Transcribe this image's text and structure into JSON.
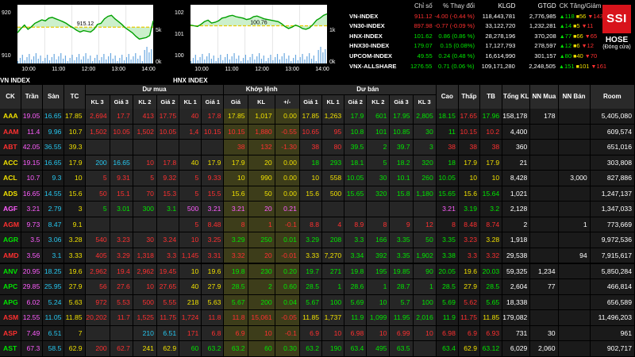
{
  "charts": [
    {
      "title": "VN INDEX",
      "ref_label": "915.12",
      "y_ticks": [
        "920",
        "910"
      ],
      "v_ticks": [
        "5k",
        "0k"
      ],
      "x_ticks": [
        "10:00",
        "11:00",
        "12:00",
        "13:00",
        "14:00"
      ]
    },
    {
      "title": "HNX INDEX",
      "ref_label": "100.76",
      "y_ticks": [
        "102",
        "101",
        "100"
      ],
      "v_ticks": [
        "1k",
        "0k"
      ],
      "x_ticks": [
        "10:00",
        "11:00",
        "12:00",
        "13:00",
        "14:00"
      ]
    }
  ],
  "index_table": {
    "headers": [
      "Chỉ số",
      "% Thay đổi",
      "KLGD",
      "GTGD",
      "CK Tăng/Giảm"
    ],
    "rows": [
      {
        "name": "VN-INDEX",
        "value": "911.12",
        "change": "-4.00 (-0.44 %)",
        "volume": "118,443,781",
        "value_traded": "2,776,985",
        "up": "118",
        "ref": "56",
        "down": "143",
        "dir": "dn"
      },
      {
        "name": "VN30-INDEX",
        "value": "897.98",
        "change": "-0.77 (-0.09 %)",
        "volume": "33,122,720",
        "value_traded": "1,232,281",
        "up": "14",
        "ref": "5",
        "down": "11",
        "dir": "dn"
      },
      {
        "name": "HNX-INDEX",
        "value": "101.62",
        "change": "0.86 (0.86 %)",
        "volume": "28,278,196",
        "value_traded": "370,208",
        "up": "77",
        "ref": "66",
        "down": "65",
        "dir": "up"
      },
      {
        "name": "HNX30-INDEX",
        "value": "179.07",
        "change": "0.15 (0.08%)",
        "volume": "17,127,793",
        "value_traded": "278,597",
        "up": "12",
        "ref": "6",
        "down": "12",
        "dir": "up"
      },
      {
        "name": "UPCOM-INDEX",
        "value": "49.55",
        "change": "0.24 (0.48 %)",
        "volume": "16,614,990",
        "value_traded": "301,157",
        "up": "80",
        "ref": "40",
        "down": "70",
        "dir": "up"
      },
      {
        "name": "VNX-ALLSHARE",
        "value": "1276.55",
        "change": "0.71 (0.06 %)",
        "volume": "109,171,280",
        "value_traded": "2,248,505",
        "up": "151",
        "ref": "101",
        "down": "161",
        "dir": "up"
      }
    ]
  },
  "brand": {
    "logo": "SSI",
    "exchange": "HOSE",
    "status": "(Đóng cửa)"
  },
  "board": {
    "groups": [
      "Dư mua",
      "Khớp lệnh",
      "Dư bán"
    ],
    "columns": [
      "CK",
      "Trần",
      "Sàn",
      "TC",
      "KL 3",
      "Giá 3",
      "KL 2",
      "Giá 2",
      "KL 1",
      "Giá 1",
      "Giá",
      "KL",
      "+/-",
      "Giá 1",
      "KL 1",
      "Giá 2",
      "KL 2",
      "Giá 3",
      "KL 3",
      "Cao",
      "Thấp",
      "TB",
      "Tổng KL",
      "NN Mua",
      "NN Bán",
      "Room"
    ],
    "rows": [
      [
        "AAA",
        "19.05",
        "16.65",
        "17.85",
        "2,694",
        "17.7",
        "413",
        "17.75",
        "40",
        "17.8",
        "17.85",
        "1,017",
        "0.00",
        "17.85",
        "1,263",
        "17.9",
        "601",
        "17.95",
        "2,805",
        "18.15",
        "17.65",
        "17.96",
        "158,178",
        "178",
        "",
        "5,405,080"
      ],
      [
        "AAM",
        "11.4",
        "9.96",
        "10.7",
        "1,502",
        "10.05",
        "1,502",
        "10.05",
        "1,4",
        "10.15",
        "10.15",
        "1,880",
        "-0.55",
        "10.65",
        "95",
        "10.8",
        "101",
        "10.85",
        "30",
        "11",
        "10.15",
        "10.2",
        "4,400",
        "",
        "",
        "609,574"
      ],
      [
        "ABT",
        "42.05",
        "36.55",
        "39.3",
        "",
        "",
        "",
        "",
        "",
        "",
        "38",
        "132",
        "-1.30",
        "38",
        "80",
        "39.5",
        "2",
        "39.7",
        "3",
        "38",
        "38",
        "38",
        "360",
        "",
        "",
        "651,016"
      ],
      [
        "ACC",
        "19.15",
        "16.65",
        "17.9",
        "200",
        "16.65",
        "10",
        "17.8",
        "40",
        "17.9",
        "17.9",
        "20",
        "0.00",
        "18",
        "293",
        "18.1",
        "5",
        "18.2",
        "320",
        "18",
        "17.9",
        "17.9",
        "21",
        "",
        "",
        "303,808"
      ],
      [
        "ACL",
        "10.7",
        "9.3",
        "10",
        "5",
        "9.31",
        "5",
        "9.32",
        "5",
        "9.33",
        "10",
        "990",
        "0.00",
        "10",
        "558",
        "10.05",
        "30",
        "10.1",
        "260",
        "10.05",
        "10",
        "10",
        "8,428",
        "",
        "3,000",
        "827,886"
      ],
      [
        "ADS",
        "16.65",
        "14.55",
        "15.6",
        "50",
        "15.1",
        "70",
        "15.3",
        "5",
        "15.5",
        "15.6",
        "50",
        "0.00",
        "15.6",
        "500",
        "15.65",
        "320",
        "15.8",
        "1,180",
        "15.65",
        "15.6",
        "15.64",
        "1,021",
        "",
        "",
        "1,247,137"
      ],
      [
        "AGF",
        "3.21",
        "2.79",
        "3",
        "5",
        "3.01",
        "300",
        "3.1",
        "500",
        "3.21",
        "3.21",
        "20",
        "0.21",
        "",
        "",
        "",
        "",
        "",
        "",
        "3.21",
        "3.19",
        "3.2",
        "2,128",
        "",
        "",
        "1,347,033"
      ],
      [
        "AGM",
        "9.73",
        "8.47",
        "9.1",
        "",
        "",
        "",
        "",
        "5",
        "8.48",
        "8",
        "1",
        "-0.1",
        "8.8",
        "4",
        "8.9",
        "8",
        "9",
        "12",
        "8",
        "8.48",
        "8.74",
        "2",
        "",
        "1",
        "773,669"
      ],
      [
        "AGR",
        "3.5",
        "3.06",
        "3.28",
        "540",
        "3.23",
        "30",
        "3.24",
        "10",
        "3.25",
        "3.29",
        "250",
        "0.01",
        "3.29",
        "208",
        "3.3",
        "166",
        "3.35",
        "50",
        "3.35",
        "3.23",
        "3.28",
        "1,918",
        "",
        "",
        "9,972,536"
      ],
      [
        "AMD",
        "3.56",
        "3.1",
        "3.33",
        "405",
        "3.29",
        "1,318",
        "3.3",
        "1,145",
        "3.31",
        "3.32",
        "20",
        "-0.01",
        "3.33",
        "7,270",
        "3.34",
        "392",
        "3.35",
        "1,902",
        "3.38",
        "3.3",
        "3.32",
        "29,538",
        "",
        "94",
        "7,915,617"
      ],
      [
        "ANV",
        "20.95",
        "18.25",
        "19.6",
        "2,962",
        "19.4",
        "2,962",
        "19.45",
        "10",
        "19.6",
        "19.8",
        "230",
        "0.20",
        "19.7",
        "271",
        "19.8",
        "195",
        "19.85",
        "90",
        "20.05",
        "19.6",
        "20.03",
        "59,325",
        "1,234",
        "",
        "5,850,284"
      ],
      [
        "APC",
        "29.85",
        "25.95",
        "27.9",
        "56",
        "27.6",
        "10",
        "27.65",
        "40",
        "27.9",
        "28.5",
        "2",
        "0.60",
        "28.5",
        "1",
        "28.6",
        "1",
        "28.7",
        "1",
        "28.5",
        "27.9",
        "28.5",
        "2,604",
        "77",
        "",
        "466,814"
      ],
      [
        "APG",
        "6.02",
        "5.24",
        "5.63",
        "972",
        "5.53",
        "500",
        "5.55",
        "218",
        "5.63",
        "5.67",
        "200",
        "0.04",
        "5.67",
        "100",
        "5.69",
        "10",
        "5.7",
        "100",
        "5.69",
        "5.62",
        "5.65",
        "18,338",
        "",
        "",
        "656,589"
      ],
      [
        "ASM",
        "12.55",
        "11.05",
        "11.85",
        "20,202",
        "11.7",
        "1,525",
        "11.75",
        "1,724",
        "11.8",
        "11.8",
        "15,061",
        "-0.05",
        "11.85",
        "1,737",
        "11.9",
        "1,099",
        "11.95",
        "2,016",
        "11.9",
        "11.75",
        "11.85",
        "179,082",
        "",
        "",
        "11,496,203"
      ],
      [
        "ASP",
        "7.49",
        "6.51",
        "7",
        "",
        "",
        "210",
        "6.51",
        "171",
        "6.8",
        "6.9",
        "10",
        "-0.1",
        "6.9",
        "10",
        "6.98",
        "10",
        "6.99",
        "10",
        "6.98",
        "6.9",
        "6.93",
        "731",
        "30",
        "",
        "961"
      ],
      [
        "AST",
        "67.3",
        "58.5",
        "62.9",
        "200",
        "62.7",
        "241",
        "62.9",
        "60",
        "63.2",
        "63.2",
        "60",
        "0.30",
        "63.2",
        "190",
        "63.4",
        "495",
        "63.5",
        "",
        "63.4",
        "62.9",
        "63.12",
        "6,029",
        "2,060",
        "",
        "902,717"
      ],
      [
        "ATG",
        "1.46",
        "1.28",
        "1.37",
        "170",
        "1.31",
        "10",
        "1.32",
        "28",
        "1.33",
        "1.41",
        "64",
        "0.04",
        "1.41",
        "64",
        "1.42",
        "100",
        "1.44",
        "75",
        "1.42",
        "1.37",
        "1.4",
        "6,994",
        "",
        "",
        "719,915"
      ]
    ]
  },
  "colors": {
    "up": "#00e600",
    "down": "#ff3030",
    "ref": "#f0e000",
    "ceil": "#ff5dff",
    "floor": "#26c7f0"
  }
}
